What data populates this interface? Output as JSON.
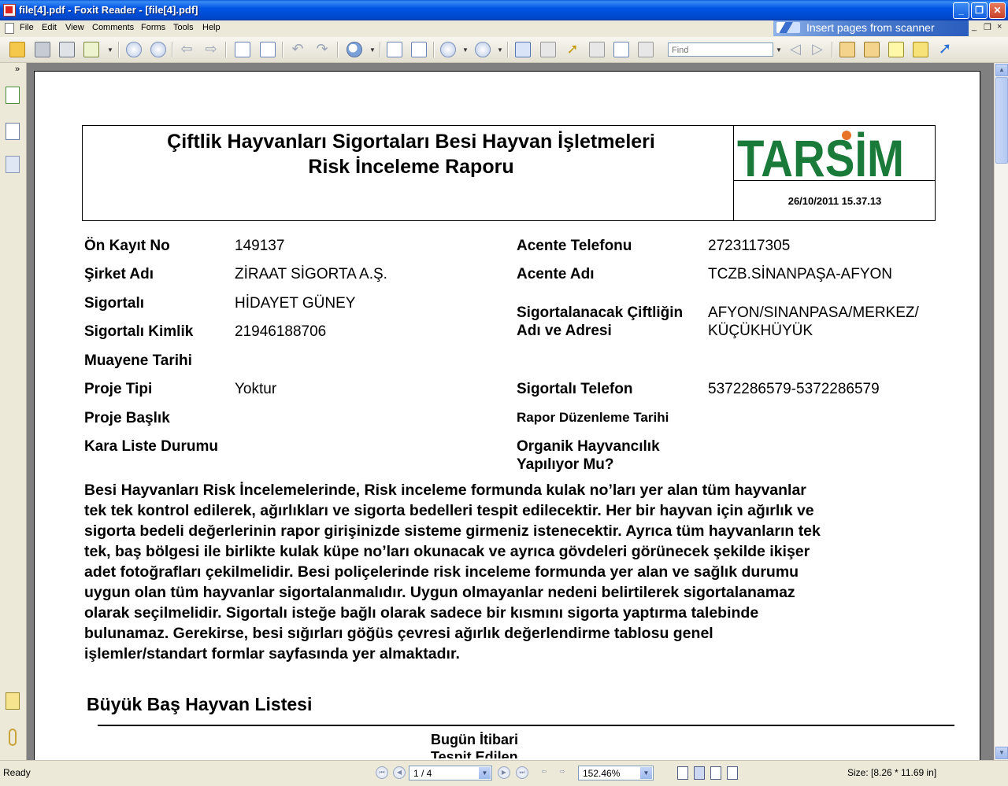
{
  "window": {
    "title": "file[4].pdf - Foxit Reader - [file[4].pdf]",
    "min_label": "_",
    "max_label": "❐",
    "close_label": "✕"
  },
  "menu": {
    "items": [
      "File",
      "Edit",
      "View",
      "Comments",
      "Forms",
      "Tools",
      "Help"
    ],
    "banner_text": "Insert pages from scanner",
    "mdi_min": "_",
    "mdi_restore": "❐",
    "mdi_close": "×"
  },
  "toolbar": {
    "find_placeholder": "Find"
  },
  "left_panel": {
    "expand_label": "»"
  },
  "document": {
    "title_line1": "Çiftlik Hayvanları Sigortaları Besi Hayvan İşletmeleri",
    "title_line2": "Risk İnceleme Raporu",
    "logo_text": "TARSİM",
    "report_datetime": "26/10/2011 15.37.13",
    "left_fields": [
      {
        "label": "Ön Kayıt No",
        "value": "149137"
      },
      {
        "label": "Şirket Adı",
        "value": "ZİRAAT SİGORTA A.Ş."
      },
      {
        "label": "Sigortalı",
        "value": "HİDAYET GÜNEY"
      },
      {
        "label": "Sigortalı Kimlik",
        "value": "21946188706"
      },
      {
        "label": "Muayene Tarihi",
        "value": ""
      },
      {
        "label": "Proje Tipi",
        "value": "Yoktur"
      },
      {
        "label": "Proje Başlık",
        "value": ""
      },
      {
        "label": "Kara Liste Durumu",
        "value": ""
      }
    ],
    "right_fields": [
      {
        "label": "Acente Telefonu",
        "value": "2723117305"
      },
      {
        "label": "Acente Adı",
        "value": "TCZB.SİNANPAŞA-AFYON"
      },
      {
        "label_line1": "Sigortalanacak Çiftliğin",
        "label_line2": "Adı ve Adresi",
        "value_line1": "AFYON/SINANPASA/MERKEZ/",
        "value_line2": "KÜÇÜKHÜYÜK"
      },
      {
        "label": "Sigortalı Telefon",
        "value": "5372286579-5372286579"
      },
      {
        "label": "Rapor Düzenleme Tarihi",
        "value": ""
      },
      {
        "label_line1": "Organik Hayvancılık",
        "label_line2": "Yapılıyor Mu?",
        "value": ""
      }
    ],
    "paragraph": [
      "Besi Hayvanları Risk İncelemelerinde, Risk inceleme formunda kulak no’ları yer alan tüm hayvanlar",
      "tek tek kontrol edilerek, ağırlıkları ve sigorta bedelleri tespit edilecektir. Her bir hayvan için ağırlık ve",
      "sigorta bedeli değerlerinin rapor girişinizde sisteme girmeniz istenecektir. Ayrıca tüm hayvanların tek",
      "tek, baş bölgesi ile birlikte kulak küpe no’ları okunacak ve ayrıca gövdeleri görünecek şekilde ikişer",
      "adet fotoğrafları çekilmelidir. Besi poliçelerinde risk inceleme formunda yer alan ve sağlık durumu",
      "uygun olan tüm hayvanlar sigortalanmalıdır. Uygun olmayanlar nedeni belirtilerek sigortalanamaz",
      "olarak seçilmelidir. Sigortalı isteğe bağlı olarak sadece bir kısmını sigorta yaptırma talebinde",
      "bulunamaz. Gerekirse, besi sığırları göğüs çevresi ağırlık değerlendirme tablosu genel",
      "işlemler/standart formlar  sayfasında yer almaktadır."
    ],
    "section_title": "Büyük Baş Hayvan Listesi",
    "column_header_line1": "Bugün İtibari",
    "column_header_line2": "Tespit Edilen"
  },
  "status": {
    "ready": "Ready",
    "page_indicator": "1 / 4",
    "zoom": "152.46%",
    "page_size": "Size: [8.26 * 11.69 in]"
  },
  "colors": {
    "titlebar": "#0054e3",
    "logo_green": "#1a7a3a",
    "logo_orange": "#e8742a"
  }
}
